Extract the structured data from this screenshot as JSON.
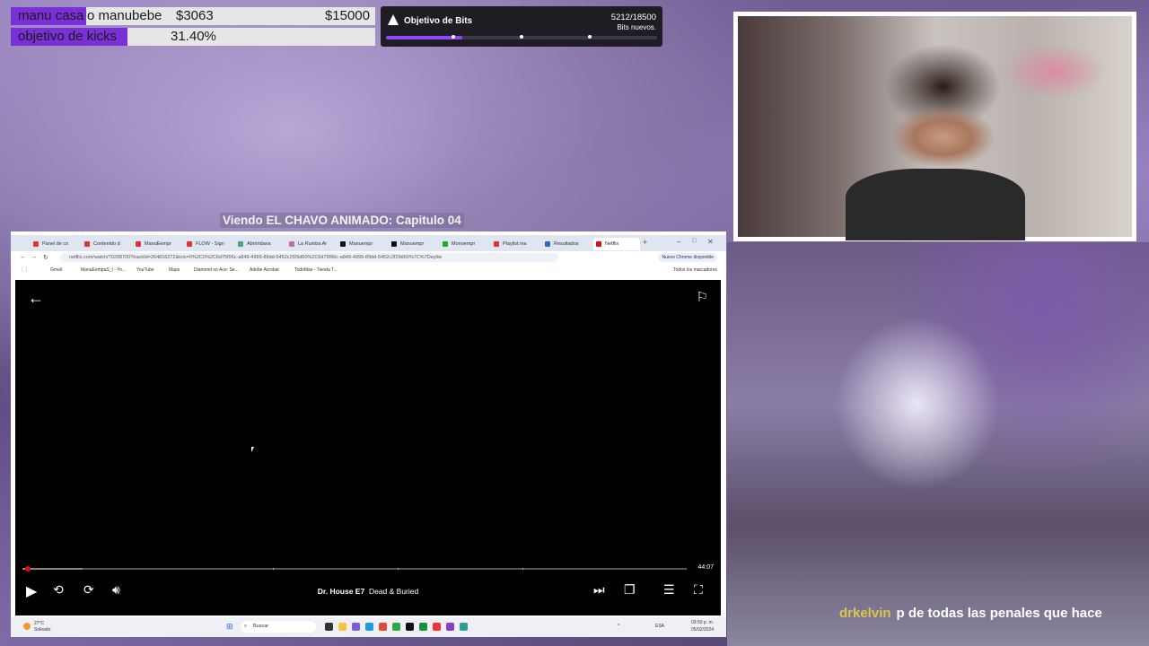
{
  "goals": [
    {
      "label_a": "manu casa",
      "label_b": "o manubebe",
      "current": "$3063",
      "target": "$15000",
      "progress": 0.204
    },
    {
      "label_a": "objetivo de kicks",
      "label_b": "",
      "current": "31.40%",
      "target": "",
      "progress": 0.314
    }
  ],
  "bits_goal": {
    "title": "Objetivo de Bits",
    "current": "5212",
    "target": "/18500",
    "subtitle": "Bits nuevos.",
    "progress": 0.2817
  },
  "caption": "Viendo EL CHAVO ANIMADO: Capitulo 04",
  "browser": {
    "tabs": [
      "Panel de co",
      "Contenido d",
      "ManuEempr",
      "FLOW - Sign",
      "Abrirridava",
      "La Rumba Ar",
      "Manuempr",
      "Manuempr",
      "Monoempr",
      "Playlist ma",
      "Resultados",
      "Netflix"
    ],
    "url": "netflix.com/watch/70298700?trackId=264816272&tctx=0%2C0%2C6d75f96c-a849-4999-89dd-5452c2f29d60%2C6d75f96c-a849-4999-89dd-5452c2f29d60%7C%7Deyliw",
    "update_label": "Nuevo Chrome disponible",
    "bookmarks": [
      "Gmail",
      "ManuEempaS_t - Yo...",
      "YouTube",
      "Maps",
      "Diamond no Ace: Se...",
      "Adobe Acrobat",
      "TodoMas - Tienda T..."
    ],
    "bookmarks_right": "Todos los marcadores"
  },
  "player": {
    "time_remaining": "44:07",
    "episode_show": "Dr. House E7",
    "episode_title": "Dead & Buried",
    "progress": 0.004,
    "buffered": 0.09
  },
  "taskbar": {
    "weather_temp": "27°C",
    "weather_desc": "Soleado",
    "search_placeholder": "Buscar",
    "lang": "ESA",
    "time": "03:50 p. m.",
    "date": "05/02/2024"
  },
  "chat": {
    "user": "drkelvin",
    "message": "p de todas las penales que hace"
  }
}
